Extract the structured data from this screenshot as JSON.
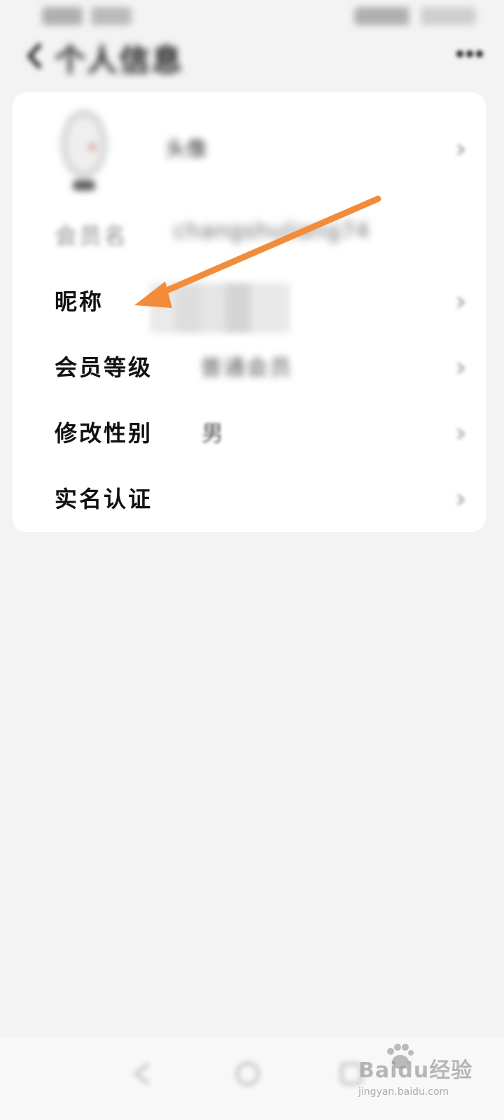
{
  "screen": {
    "title": "个人信息",
    "accent_color": "#f28c3a"
  },
  "profile": {
    "avatar_row_label": "头像",
    "rows": [
      {
        "key": "member_name",
        "label": "会员名",
        "value": "changshuliang74"
      },
      {
        "key": "nickname",
        "label": "昵称",
        "value": ""
      },
      {
        "key": "member_level",
        "label": "会员等级",
        "value": "普通会员"
      },
      {
        "key": "gender",
        "label": "修改性别",
        "value": "男"
      },
      {
        "key": "verification",
        "label": "实名认证",
        "value": ""
      }
    ]
  },
  "system_nav": {
    "icons": [
      "back-icon",
      "home-icon",
      "recent-apps-icon"
    ]
  },
  "watermark": {
    "brand": "Baidu经验",
    "url": "jingyan.baidu.com"
  }
}
